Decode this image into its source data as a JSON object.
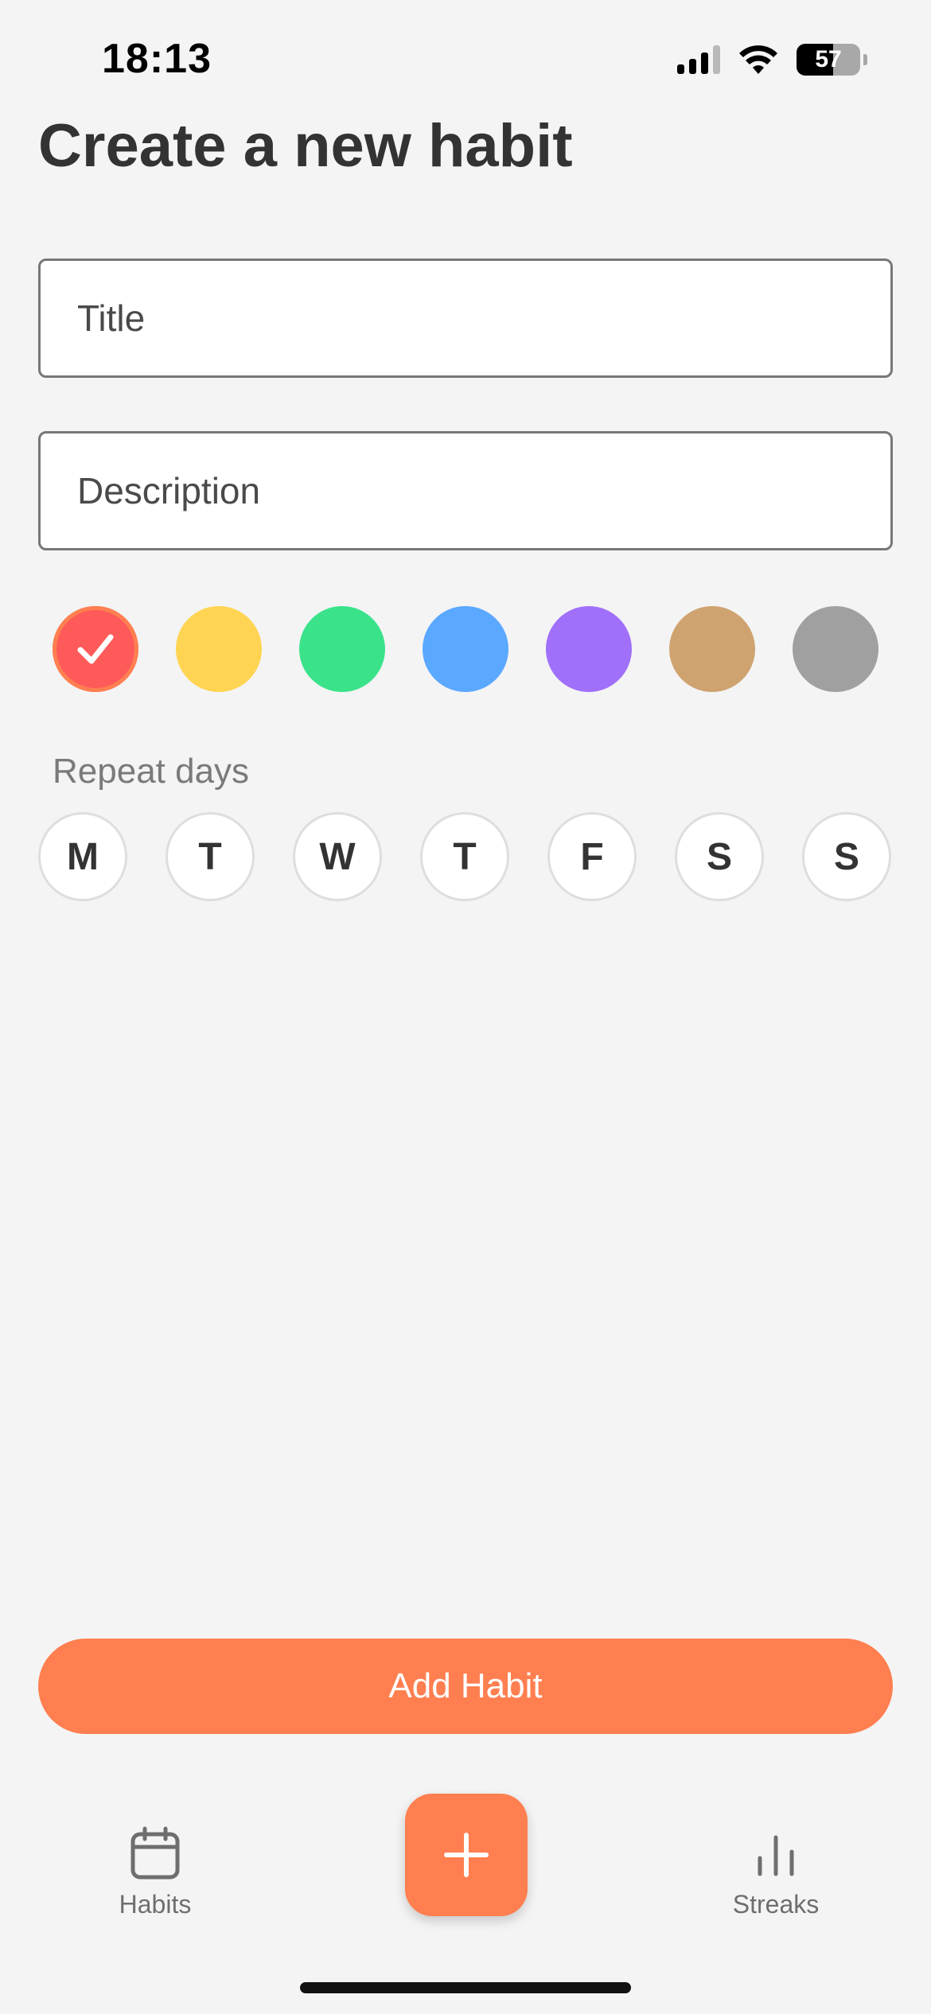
{
  "status_bar": {
    "time": "18:13",
    "battery": "57",
    "battery_level": 0.57
  },
  "title": "Create a new habit",
  "form": {
    "title_placeholder": "Title",
    "description_placeholder": "Description"
  },
  "colors": [
    {
      "hex": "#ff5a5a",
      "selected": true
    },
    {
      "hex": "#ffd452",
      "selected": false
    },
    {
      "hex": "#3ae38a",
      "selected": false
    },
    {
      "hex": "#5aa8ff",
      "selected": false
    },
    {
      "hex": "#a070fa",
      "selected": false
    },
    {
      "hex": "#cfa370",
      "selected": false
    },
    {
      "hex": "#a0a0a0",
      "selected": false
    }
  ],
  "repeat": {
    "label": "Repeat days",
    "days": [
      "M",
      "T",
      "W",
      "T",
      "F",
      "S",
      "S"
    ]
  },
  "add_button_label": "Add Habit",
  "tabs": {
    "habits": {
      "label": "Habits",
      "icon": "calendar-icon"
    },
    "add": {
      "icon": "plus-icon"
    },
    "streaks": {
      "label": "Streaks",
      "icon": "bar-chart-icon"
    }
  },
  "accent_color": "#ff7f50"
}
